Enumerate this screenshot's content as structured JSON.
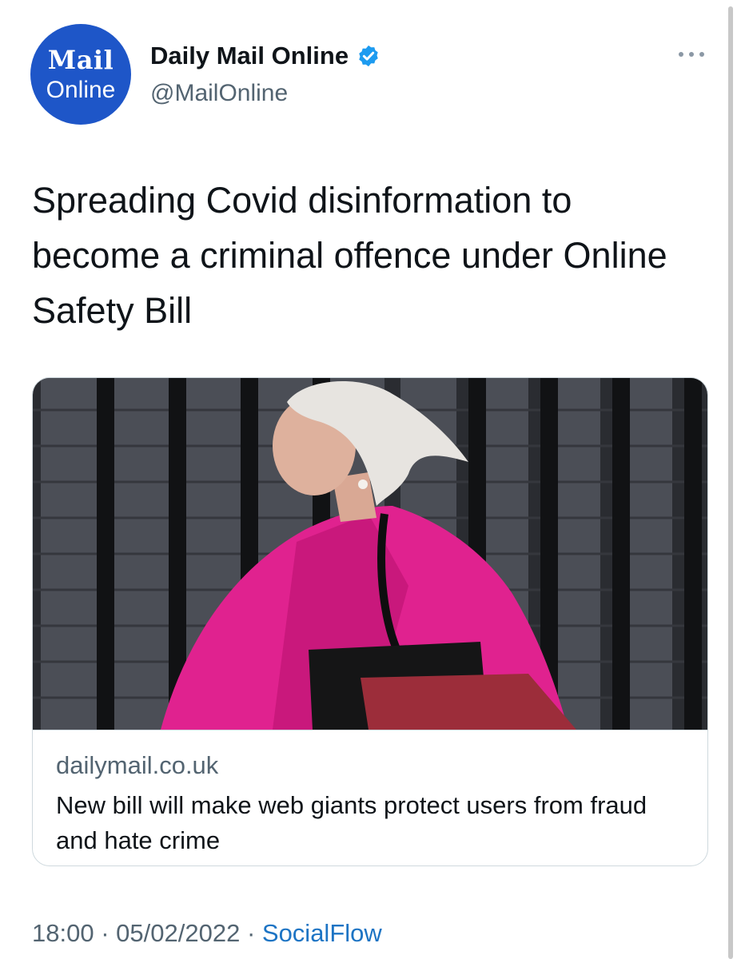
{
  "account": {
    "avatar_logo_top": "Mail",
    "avatar_logo_bottom": "Online",
    "display_name": "Daily Mail Online",
    "handle": "@MailOnline",
    "verified": true
  },
  "tweet": {
    "text": "Spreading Covid disinformation to become a criminal offence under Online Safety Bill"
  },
  "link_card": {
    "domain": "dailymail.co.uk",
    "title": "New bill will make web giants protect users from fraud and hate crime"
  },
  "meta": {
    "time": "18:00",
    "separator": "·",
    "date": "05/02/2022",
    "source": "SocialFlow"
  },
  "icons": {
    "verified": "verified-badge-icon",
    "more": "more-options-icon"
  },
  "colors": {
    "brand_blue": "#1e56c8",
    "verified_blue": "#1d9bf0",
    "link_blue": "#1d74c4",
    "muted_text": "#536471",
    "jacket_pink": "#e0228f"
  }
}
